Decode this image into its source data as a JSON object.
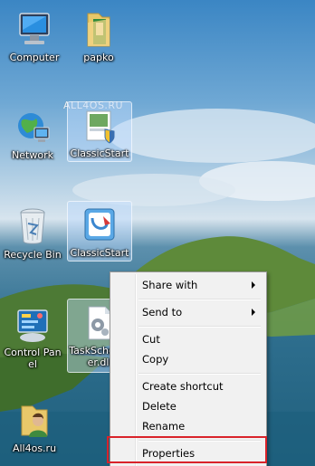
{
  "desktop": {
    "watermark": "ALL4OS.RU",
    "icons": [
      {
        "label": "Computer",
        "icon": "computer-icon"
      },
      {
        "label": "papko",
        "icon": "folder-icon"
      },
      {
        "label": "Network",
        "icon": "network-icon"
      },
      {
        "label": "ClassicStart",
        "icon": "classicstart-shield-icon"
      },
      {
        "label": "Recycle Bin",
        "icon": "recycle-bin-icon"
      },
      {
        "label": "ClassicStart",
        "icon": "classicstart-icon"
      },
      {
        "label": "Control Panel",
        "icon": "control-panel-icon"
      },
      {
        "label": "TaskScheduler.dll",
        "icon": "dll-file-icon"
      },
      {
        "label": "All4os.ru",
        "icon": "user-folder-icon"
      }
    ]
  },
  "context_menu": {
    "items": [
      {
        "label": "Share with",
        "submenu": true
      },
      {
        "label": "Send to",
        "submenu": true
      },
      {
        "label": "Cut",
        "submenu": false
      },
      {
        "label": "Copy",
        "submenu": false
      },
      {
        "label": "Create shortcut",
        "submenu": false
      },
      {
        "label": "Delete",
        "submenu": false
      },
      {
        "label": "Rename",
        "submenu": false
      },
      {
        "label": "Properties",
        "submenu": false
      }
    ],
    "highlight_color": "#d9232a"
  }
}
